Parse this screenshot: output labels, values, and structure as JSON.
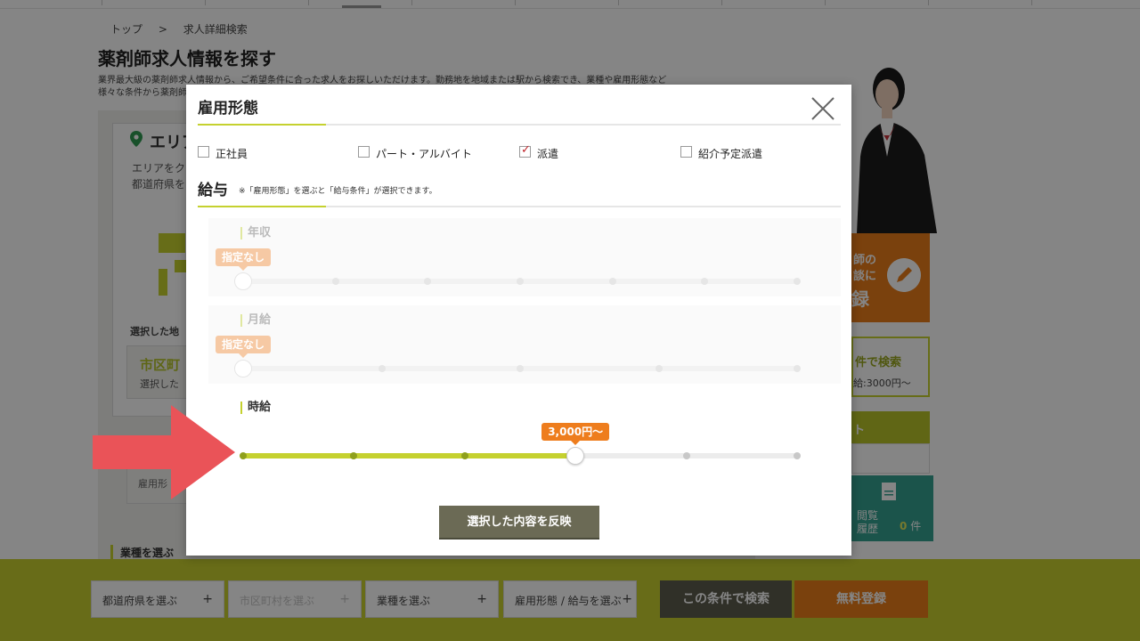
{
  "breadcrumb": {
    "home": "トップ",
    "sep": ">",
    "current": "求人詳細検索"
  },
  "page": {
    "title": "薬剤師求人情報を探す",
    "desc_line1": "業界最大級の薬剤師求人情報から、ご希望条件に合った求人をお探しいただけます。勤務地を地域または駅から検索でき、業種や雇用形態など",
    "desc_line2": "様々な条件から薬剤師"
  },
  "area_card": {
    "title": "エリア",
    "text_line1": "エリアをク",
    "text_line2": "都道府県を",
    "selected_label": "選択した地",
    "city_title": "市区町",
    "city_sub": "選択した"
  },
  "koyo_box": {
    "label": "雇用形"
  },
  "gyoshu_heading": "業種を選ぶ",
  "right_col": {
    "cta_line1": "師の",
    "cta_line2": "談に",
    "cta_line3": "録",
    "search_title": "件で検索",
    "search_sub": "給:3000円〜",
    "olive_title": "ト",
    "history_line1": "閲覧",
    "history_line2": "履歴",
    "history_count": "0",
    "history_unit": "件"
  },
  "bottom_bar": {
    "prefecture": "都道府県を選ぶ",
    "city": "市区町村を選ぶ",
    "industry": "業種を選ぶ",
    "employment": "雇用形態 / 給与を選ぶ",
    "plus": "+",
    "search": "この条件で検索",
    "register": "無料登録"
  },
  "modal": {
    "title": "雇用形態",
    "employment_types": [
      {
        "label": "正社員",
        "checked": false
      },
      {
        "label": "パート・アルバイト",
        "checked": false
      },
      {
        "label": "派遣",
        "checked": true
      },
      {
        "label": "紹介予定派遣",
        "checked": false
      }
    ],
    "check_mark": "✓",
    "salary_title": "給与",
    "salary_note": "※「雇用形態」を選ぶと「給与条件」が選択できます。",
    "sliders": [
      {
        "label": "年収",
        "value_label": "指定なし",
        "enabled": false,
        "stops": 7,
        "position": 0
      },
      {
        "label": "月給",
        "value_label": "指定なし",
        "enabled": false,
        "stops": 5,
        "position": 0
      },
      {
        "label": "時給",
        "value_label": "3,000円～",
        "enabled": true,
        "stops": 6,
        "position": 3
      }
    ],
    "apply_label": "選択した内容を反映"
  },
  "colors": {
    "accent": "#c5d12f",
    "orange": "#ee7d1d",
    "check": "#c1272d",
    "arrow": "#ea5358"
  }
}
